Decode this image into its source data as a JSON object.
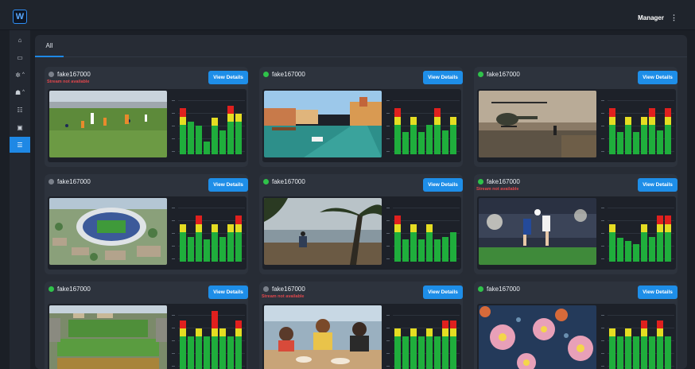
{
  "app": {
    "logo_letter": "W"
  },
  "header": {
    "user_name": "Manager",
    "user_caret": "⋮"
  },
  "sidebar": {
    "items": [
      {
        "name": "home-icon",
        "glyph": "⌂",
        "sub": "",
        "active": false
      },
      {
        "name": "monitor-icon",
        "glyph": "▭",
        "sub": "",
        "active": false
      },
      {
        "name": "gear-icon",
        "glyph": "✲",
        "sub": "^",
        "active": false
      },
      {
        "name": "users-icon",
        "glyph": "☗",
        "sub": "^",
        "active": false
      },
      {
        "name": "group-icon",
        "glyph": "☷",
        "sub": "",
        "active": false
      },
      {
        "name": "device-icon",
        "glyph": "▣",
        "sub": "",
        "active": false
      },
      {
        "name": "list-icon",
        "glyph": "☰",
        "sub": "",
        "active": true
      }
    ]
  },
  "tabs": [
    {
      "label": "All"
    }
  ],
  "colors": {
    "accent": "#1e88e5",
    "online": "#2fc24a",
    "offline": "#7a808a",
    "error": "#e0474c",
    "meter_green": "#1fae3c",
    "meter_yellow": "#e5dd22",
    "meter_red": "#e0201e"
  },
  "streams": [
    {
      "name": "fake167000",
      "status": "offline",
      "error": "Stream not available",
      "button": "View Details",
      "thumbnail": "field-sports-scene",
      "levels": [
        {
          "g": 0.5,
          "y": 0.14,
          "r": 0.14
        },
        {
          "g": 0.55,
          "y": 0,
          "r": 0
        },
        {
          "g": 0.48,
          "y": 0,
          "r": 0
        },
        {
          "g": 0.22,
          "y": 0,
          "r": 0
        },
        {
          "g": 0.48,
          "y": 0.14,
          "r": 0
        },
        {
          "g": 0.4,
          "y": 0,
          "r": 0
        },
        {
          "g": 0.55,
          "y": 0.14,
          "r": 0.14
        },
        {
          "g": 0.55,
          "y": 0.14,
          "r": 0
        }
      ]
    },
    {
      "name": "fake167000",
      "status": "online",
      "error": "",
      "button": "View Details",
      "thumbnail": "venice-canal-scene",
      "levels": [
        {
          "g": 0.5,
          "y": 0.14,
          "r": 0.14
        },
        {
          "g": 0.38,
          "y": 0,
          "r": 0
        },
        {
          "g": 0.5,
          "y": 0.14,
          "r": 0
        },
        {
          "g": 0.38,
          "y": 0,
          "r": 0
        },
        {
          "g": 0.5,
          "y": 0,
          "r": 0
        },
        {
          "g": 0.5,
          "y": 0.14,
          "r": 0.14
        },
        {
          "g": 0.4,
          "y": 0,
          "r": 0
        },
        {
          "g": 0.5,
          "y": 0.14,
          "r": 0
        }
      ]
    },
    {
      "name": "fake167000",
      "status": "online",
      "error": "",
      "button": "View Details",
      "thumbnail": "helicopter-scene",
      "levels": [
        {
          "g": 0.5,
          "y": 0.14,
          "r": 0.14
        },
        {
          "g": 0.38,
          "y": 0,
          "r": 0
        },
        {
          "g": 0.5,
          "y": 0.14,
          "r": 0
        },
        {
          "g": 0.38,
          "y": 0,
          "r": 0
        },
        {
          "g": 0.5,
          "y": 0.14,
          "r": 0
        },
        {
          "g": 0.5,
          "y": 0.14,
          "r": 0.14
        },
        {
          "g": 0.4,
          "y": 0,
          "r": 0
        },
        {
          "g": 0.5,
          "y": 0.14,
          "r": 0.14
        }
      ]
    },
    {
      "name": "fake167000",
      "status": "offline",
      "error": "",
      "button": "View Details",
      "thumbnail": "stadium-aerial-scene",
      "levels": [
        {
          "g": 0.5,
          "y": 0.14,
          "r": 0
        },
        {
          "g": 0.42,
          "y": 0,
          "r": 0
        },
        {
          "g": 0.5,
          "y": 0.14,
          "r": 0.14
        },
        {
          "g": 0.38,
          "y": 0,
          "r": 0
        },
        {
          "g": 0.5,
          "y": 0.14,
          "r": 0
        },
        {
          "g": 0.42,
          "y": 0,
          "r": 0
        },
        {
          "g": 0.5,
          "y": 0.14,
          "r": 0
        },
        {
          "g": 0.5,
          "y": 0.14,
          "r": 0.14
        }
      ]
    },
    {
      "name": "fake167000",
      "status": "online",
      "error": "",
      "button": "View Details",
      "thumbnail": "beach-palm-scene",
      "levels": [
        {
          "g": 0.5,
          "y": 0.14,
          "r": 0.14
        },
        {
          "g": 0.38,
          "y": 0,
          "r": 0
        },
        {
          "g": 0.5,
          "y": 0.14,
          "r": 0
        },
        {
          "g": 0.38,
          "y": 0,
          "r": 0
        },
        {
          "g": 0.5,
          "y": 0.14,
          "r": 0
        },
        {
          "g": 0.38,
          "y": 0,
          "r": 0
        },
        {
          "g": 0.42,
          "y": 0,
          "r": 0
        },
        {
          "g": 0.5,
          "y": 0,
          "r": 0
        }
      ]
    },
    {
      "name": "fake167000",
      "status": "online",
      "error": "Stream not available",
      "button": "View Details",
      "thumbnail": "soccer-players-scene",
      "levels": [
        {
          "g": 0.5,
          "y": 0.14,
          "r": 0
        },
        {
          "g": 0.4,
          "y": 0,
          "r": 0
        },
        {
          "g": 0.35,
          "y": 0,
          "r": 0
        },
        {
          "g": 0.3,
          "y": 0,
          "r": 0
        },
        {
          "g": 0.5,
          "y": 0.14,
          "r": 0
        },
        {
          "g": 0.42,
          "y": 0,
          "r": 0
        },
        {
          "g": 0.5,
          "y": 0.14,
          "r": 0.14
        },
        {
          "g": 0.5,
          "y": 0.14,
          "r": 0.14
        }
      ]
    },
    {
      "name": "fake167000",
      "status": "online",
      "error": "",
      "button": "View Details",
      "thumbnail": "sports-field-aerial-scene",
      "levels": [
        {
          "g": 0.55,
          "y": 0.14,
          "r": 0.14
        },
        {
          "g": 0.55,
          "y": 0,
          "r": 0
        },
        {
          "g": 0.55,
          "y": 0.14,
          "r": 0
        },
        {
          "g": 0.55,
          "y": 0,
          "r": 0
        },
        {
          "g": 0.55,
          "y": 0.14,
          "r": 0.3
        },
        {
          "g": 0.55,
          "y": 0.14,
          "r": 0
        },
        {
          "g": 0.55,
          "y": 0,
          "r": 0
        },
        {
          "g": 0.55,
          "y": 0.14,
          "r": 0.14
        }
      ]
    },
    {
      "name": "fake167000",
      "status": "offline",
      "error": "Stream not available",
      "button": "View Details",
      "thumbnail": "friends-dining-scene",
      "levels": [
        {
          "g": 0.55,
          "y": 0.14,
          "r": 0
        },
        {
          "g": 0.55,
          "y": 0,
          "r": 0
        },
        {
          "g": 0.55,
          "y": 0.14,
          "r": 0
        },
        {
          "g": 0.55,
          "y": 0,
          "r": 0
        },
        {
          "g": 0.55,
          "y": 0.14,
          "r": 0
        },
        {
          "g": 0.55,
          "y": 0,
          "r": 0
        },
        {
          "g": 0.55,
          "y": 0.14,
          "r": 0.14
        },
        {
          "g": 0.55,
          "y": 0.14,
          "r": 0.14
        }
      ]
    },
    {
      "name": "fake167000",
      "status": "online",
      "error": "",
      "button": "View Details",
      "thumbnail": "flowers-closeup-scene",
      "levels": [
        {
          "g": 0.55,
          "y": 0.14,
          "r": 0
        },
        {
          "g": 0.55,
          "y": 0,
          "r": 0
        },
        {
          "g": 0.55,
          "y": 0.14,
          "r": 0
        },
        {
          "g": 0.55,
          "y": 0,
          "r": 0
        },
        {
          "g": 0.55,
          "y": 0.14,
          "r": 0.14
        },
        {
          "g": 0.55,
          "y": 0,
          "r": 0
        },
        {
          "g": 0.55,
          "y": 0.14,
          "r": 0.14
        },
        {
          "g": 0.55,
          "y": 0,
          "r": 0
        }
      ]
    }
  ]
}
